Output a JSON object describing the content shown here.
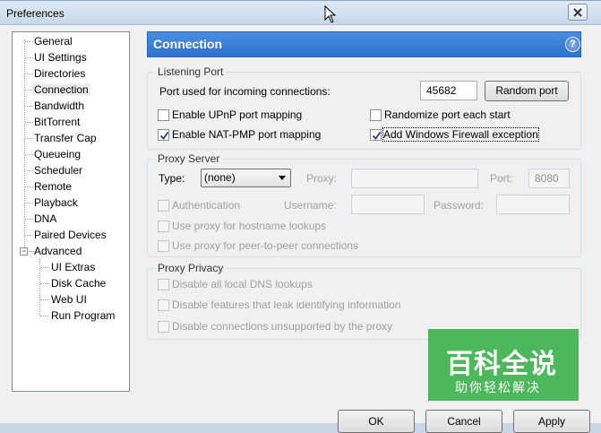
{
  "window": {
    "title": "Preferences"
  },
  "tree": {
    "items": [
      {
        "label": "General"
      },
      {
        "label": "UI Settings"
      },
      {
        "label": "Directories"
      },
      {
        "label": "Connection"
      },
      {
        "label": "Bandwidth"
      },
      {
        "label": "BitTorrent"
      },
      {
        "label": "Transfer Cap"
      },
      {
        "label": "Queueing"
      },
      {
        "label": "Scheduler"
      },
      {
        "label": "Remote"
      },
      {
        "label": "Playback"
      },
      {
        "label": "DNA"
      },
      {
        "label": "Paired Devices"
      },
      {
        "label": "Advanced"
      }
    ],
    "sub_items": [
      {
        "label": "UI Extras"
      },
      {
        "label": "Disk Cache"
      },
      {
        "label": "Web UI"
      },
      {
        "label": "Run Program"
      }
    ],
    "selected": "Connection"
  },
  "header": {
    "title": "Connection",
    "help": "?"
  },
  "listening_port": {
    "title": "Listening Port",
    "port_label": "Port used for incoming connections:",
    "port_value": "45682",
    "random_button": "Random port",
    "upnp_label": "Enable UPnP port mapping",
    "upnp_checked": false,
    "natpmp_label": "Enable NAT-PMP port mapping",
    "natpmp_checked": true,
    "randomize_label": "Randomize port each start",
    "randomize_checked": false,
    "firewall_label": "Add Windows Firewall exception",
    "firewall_checked": true
  },
  "proxy_server": {
    "title": "Proxy Server",
    "type_label": "Type:",
    "type_value": "(none)",
    "proxy_label": "Proxy:",
    "port_label": "Port:",
    "port_value": "8080",
    "auth_label": "Authentication",
    "username_label": "Username:",
    "password_label": "Password:",
    "hostname_lookups_label": "Use proxy for hostname lookups",
    "p2p_label": "Use proxy for peer-to-peer connections"
  },
  "proxy_privacy": {
    "title": "Proxy Privacy",
    "dns_label": "Disable all local DNS lookups",
    "leak_label": "Disable features that leak identifying information",
    "unsupported_label": "Disable connections unsupported by the proxy"
  },
  "buttons": {
    "ok": "OK",
    "cancel": "Cancel",
    "apply": "Apply"
  },
  "watermark": {
    "main": "百科全说",
    "sub": "助你轻松解决",
    "color": "#3fb34f"
  }
}
